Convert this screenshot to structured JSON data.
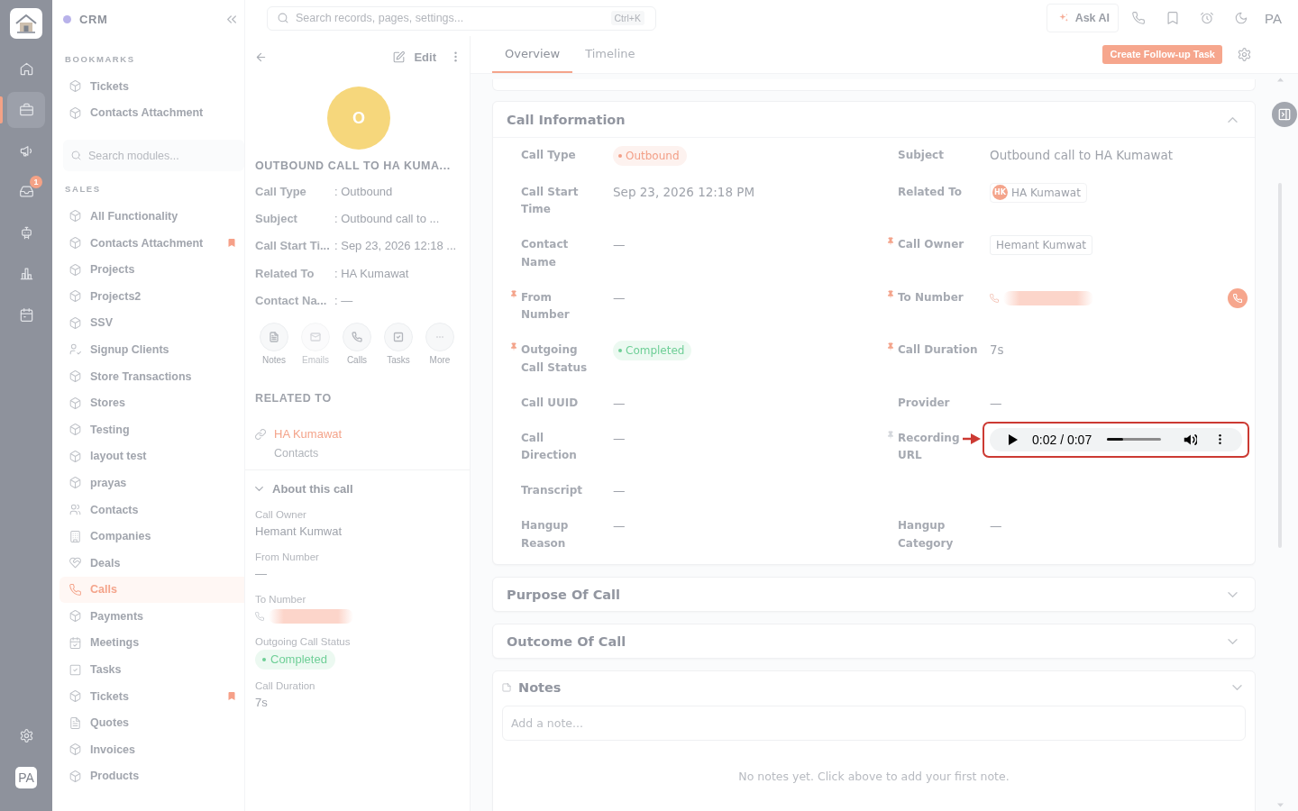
{
  "rail": {
    "items": [
      {
        "selected": false
      },
      {
        "selected": true
      },
      {
        "selected": false
      },
      {
        "selected": false,
        "badge": "1"
      },
      {
        "selected": false
      },
      {
        "selected": false
      },
      {
        "selected": false
      }
    ],
    "avatar": "PA"
  },
  "sidebar": {
    "title": "CRM",
    "bookmarks": {
      "heading": "BOOKMARKS",
      "items": [
        {
          "label": "Tickets",
          "selected": false
        },
        {
          "label": "Contacts Attachment",
          "selected": false
        }
      ]
    },
    "search": {
      "placeholder": "Search modules..."
    },
    "sales": {
      "heading": "SALES",
      "items": [
        {
          "label": "All Functionality",
          "selected": false,
          "bookmarked": false
        },
        {
          "label": "Contacts Attachment",
          "selected": false,
          "bookmarked": true
        },
        {
          "label": "Projects",
          "selected": false,
          "bookmarked": false
        },
        {
          "label": "Projects2",
          "selected": false,
          "bookmarked": false
        },
        {
          "label": "SSV",
          "selected": false,
          "bookmarked": false
        },
        {
          "label": "Signup Clients",
          "selected": false,
          "bookmarked": false
        },
        {
          "label": "Store Transactions",
          "selected": false,
          "bookmarked": false
        },
        {
          "label": "Stores",
          "selected": false,
          "bookmarked": false
        },
        {
          "label": "Testing",
          "selected": false,
          "bookmarked": false
        },
        {
          "label": "layout test",
          "selected": false,
          "bookmarked": false
        },
        {
          "label": "prayas",
          "selected": false,
          "bookmarked": false
        },
        {
          "label": "Contacts",
          "selected": false,
          "bookmarked": false
        },
        {
          "label": "Companies",
          "selected": false,
          "bookmarked": false
        },
        {
          "label": "Deals",
          "selected": false,
          "bookmarked": false
        },
        {
          "label": "Calls",
          "selected": true,
          "bookmarked": false
        },
        {
          "label": "Payments",
          "selected": false,
          "bookmarked": false
        },
        {
          "label": "Meetings",
          "selected": false,
          "bookmarked": false
        },
        {
          "label": "Tasks",
          "selected": false,
          "bookmarked": false
        },
        {
          "label": "Tickets",
          "selected": false,
          "bookmarked": true
        },
        {
          "label": "Quotes",
          "selected": false,
          "bookmarked": false
        },
        {
          "label": "Invoices",
          "selected": false,
          "bookmarked": false
        },
        {
          "label": "Products",
          "selected": false,
          "bookmarked": false
        }
      ]
    }
  },
  "topbar": {
    "search": {
      "placeholder": "Search records, pages, settings...",
      "shortcut": "Ctrl+K"
    },
    "ask_ai": "Ask AI",
    "user": "PA"
  },
  "record": {
    "avatar": "O",
    "title": "OUTBOUND CALL TO HA KUMA...",
    "edit": "Edit",
    "summary": [
      {
        "label": "Call Type",
        "value": ": Outbound"
      },
      {
        "label": "Subject",
        "value": ": Outbound call to ..."
      },
      {
        "label": "Call Start Ti...",
        "value": ": Sep 23, 2026 12:18 ..."
      },
      {
        "label": "Related To",
        "value": ": HA Kumawat"
      },
      {
        "label": "Contact Na...",
        "value": ": —"
      }
    ],
    "actions": [
      {
        "label": "Notes",
        "disabled": false
      },
      {
        "label": "Emails",
        "disabled": true
      },
      {
        "label": "Calls",
        "disabled": false
      },
      {
        "label": "Tasks",
        "disabled": false
      },
      {
        "label": "More",
        "disabled": false
      }
    ],
    "related": {
      "heading": "RELATED TO",
      "items": [
        {
          "name": "HA Kumawat",
          "module": "Contacts"
        }
      ]
    },
    "about": {
      "title": "About this call",
      "expanded": true,
      "fields": [
        {
          "label": "Call Owner",
          "kind": "text",
          "value": "Hemant Kumwat"
        },
        {
          "label": "From Number",
          "kind": "text",
          "value": "—"
        },
        {
          "label": "To Number",
          "kind": "phone"
        },
        {
          "label": "Outgoing Call Status",
          "kind": "badge",
          "value": "Completed",
          "color": "#6fcf97"
        },
        {
          "label": "Call Duration",
          "kind": "text",
          "value": "7s"
        }
      ]
    }
  },
  "main": {
    "tabs": [
      {
        "label": "Overview",
        "selected": true
      },
      {
        "label": "Timeline",
        "selected": false
      }
    ],
    "create_button": "Create Follow-up Task",
    "sections": [
      {
        "title": "Call Information",
        "expanded": true,
        "rows": [
          {
            "left": {
              "label": "Call Type",
              "kind": "badge",
              "value": "Outbound",
              "color": "#f3a088",
              "pinned": false
            },
            "right": {
              "label": "Subject",
              "kind": "text",
              "value": "Outbound call to HA Kumawat",
              "pinned": false
            }
          },
          {
            "left": {
              "label": "Call Start Time",
              "kind": "text",
              "value": "Sep 23, 2026 12:18 PM",
              "pinned": false
            },
            "right": {
              "label": "Related To",
              "kind": "chip",
              "initials": "HK",
              "value": "HA Kumawat",
              "pinned": false
            }
          },
          {
            "left": {
              "label": "Contact Name",
              "kind": "text",
              "value": "—",
              "pinned": false
            },
            "right": {
              "label": "Call Owner",
              "kind": "boxed",
              "value": "Hemant Kumwat",
              "pinned": true
            }
          },
          {
            "left": {
              "label": "From Number",
              "kind": "text",
              "value": "—",
              "pinned": true
            },
            "right": {
              "label": "To Number",
              "kind": "phone",
              "pinned": true
            }
          },
          {
            "left": {
              "label": "Outgoing Call Status",
              "kind": "badge",
              "value": "Completed",
              "color": "#6fcf97",
              "pinned": true
            },
            "right": {
              "label": "Call Duration",
              "kind": "text",
              "value": "7s",
              "pinned": true
            }
          },
          {
            "left": {
              "label": "Call UUID",
              "kind": "text",
              "value": "—",
              "pinned": false
            },
            "right": {
              "label": "Provider",
              "kind": "text",
              "value": "—",
              "pinned": false
            }
          },
          {
            "left": {
              "label": "Call Direction",
              "kind": "text",
              "value": "—",
              "pinned": false
            },
            "right": {
              "label": "Recording URL",
              "kind": "audio",
              "time": "0:02 / 0:07",
              "level": 0.3,
              "highlighted": true,
              "pinned": false,
              "hovered": true
            }
          },
          {
            "left": {
              "label": "Transcript",
              "kind": "text",
              "value": "—",
              "pinned": false
            }
          },
          {
            "left": {
              "label": "Hangup Reason",
              "kind": "text",
              "value": "—",
              "pinned": false
            },
            "right": {
              "label": "Hangup Category",
              "kind": "text",
              "value": "—",
              "pinned": false
            }
          }
        ]
      },
      {
        "title": "Purpose Of Call",
        "expanded": false
      },
      {
        "title": "Outcome Of Call",
        "expanded": false
      }
    ],
    "notes": {
      "title": "Notes",
      "placeholder": "Add a note...",
      "empty_text": "No notes yet. Click above to add your first note."
    }
  }
}
